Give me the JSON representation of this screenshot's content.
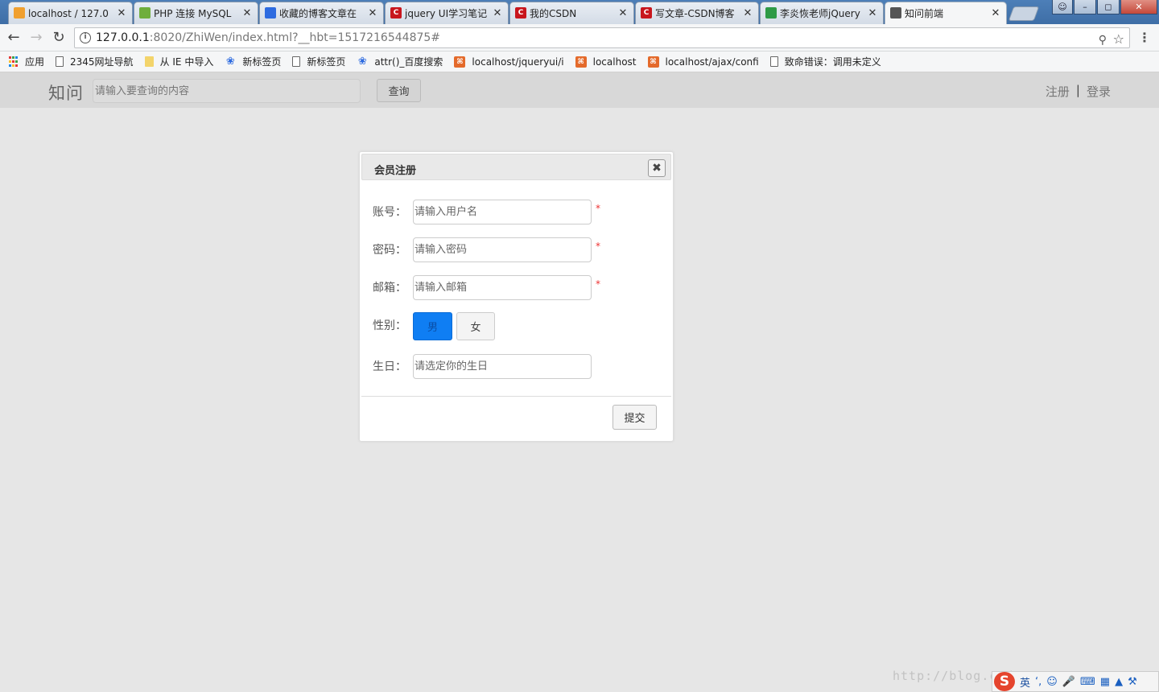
{
  "browser": {
    "tabs": [
      {
        "title": "localhost / 127.0",
        "favicon": "pma-icon",
        "color": "#f0a030",
        "glyph": "",
        "active": false
      },
      {
        "title": "PHP 连接 MySQL",
        "favicon": "php-icon",
        "color": "#6fae3c",
        "glyph": "",
        "active": false
      },
      {
        "title": "收藏的博客文章在",
        "favicon": "baidu-icon",
        "color": "#2d6be0",
        "glyph": "",
        "active": false
      },
      {
        "title": "jquery UI学习笔记",
        "favicon": "csdn-icon",
        "color": "#c8161d",
        "glyph": "C",
        "active": false
      },
      {
        "title": "我的CSDN",
        "favicon": "csdn-icon",
        "color": "#c8161d",
        "glyph": "C",
        "active": false
      },
      {
        "title": "写文章-CSDN博客",
        "favicon": "csdn-icon",
        "color": "#c8161d",
        "glyph": "C",
        "active": false
      },
      {
        "title": "李炎恢老师jQuery",
        "favicon": "book-icon",
        "color": "#2e9a46",
        "glyph": "",
        "active": false
      },
      {
        "title": "知问前端",
        "favicon": "page-icon",
        "color": "#555555",
        "glyph": "",
        "active": true
      }
    ],
    "address": {
      "host": "127.0.0.1",
      "path": ":8020/ZhiWen/index.html?__hbt=1517216544875#"
    },
    "bookmarks": [
      {
        "label": "应用",
        "icon": "apps"
      },
      {
        "label": "2345网址导航",
        "icon": "page"
      },
      {
        "label": "从 IE 中导入",
        "icon": "folder"
      },
      {
        "label": "新标签页",
        "icon": "paw"
      },
      {
        "label": "新标签页",
        "icon": "page"
      },
      {
        "label": "attr()_百度搜索",
        "icon": "paw"
      },
      {
        "label": "localhost/jqueryui/i",
        "icon": "h5"
      },
      {
        "label": "localhost",
        "icon": "h5"
      },
      {
        "label": "localhost/ajax/confi",
        "icon": "h5"
      },
      {
        "label": "致命错误：调用未定义",
        "icon": "page"
      }
    ]
  },
  "site": {
    "logo": "知问",
    "search_placeholder": "请输入要查询的内容",
    "search_button": "查询",
    "register_link": "注册",
    "separator": "|",
    "login_link": "登录"
  },
  "dialog": {
    "title": "会员注册",
    "close_glyph": "✖",
    "fields": {
      "account_label": "账号：",
      "account_placeholder": "请输入用户名",
      "password_label": "密码：",
      "password_placeholder": "请输入密码",
      "email_label": "邮箱：",
      "email_placeholder": "请输入邮箱",
      "gender_label": "性别：",
      "gender_male": "男",
      "gender_female": "女",
      "birthday_label": "生日：",
      "birthday_placeholder": "请选定你的生日"
    },
    "required_mark": "*",
    "submit": "提交"
  },
  "watermark": "http://blog.csdn.net/qq_35155142",
  "ime": {
    "logo": "S",
    "mode": "英"
  },
  "colors": {
    "male_selected": "#0f7ef3",
    "required": "#ee3333",
    "page_bg": "#e6e6e6"
  }
}
